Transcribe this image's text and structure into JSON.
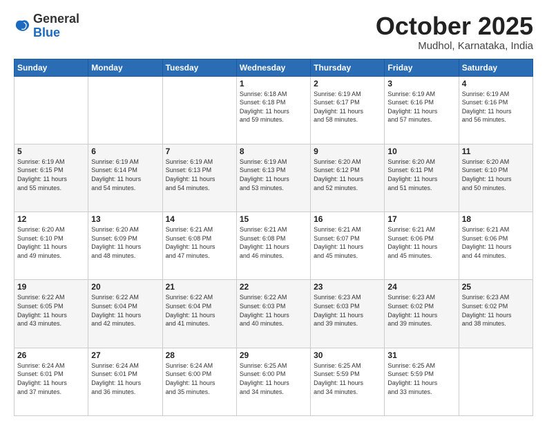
{
  "header": {
    "logo_general": "General",
    "logo_blue": "Blue",
    "month": "October 2025",
    "location": "Mudhol, Karnataka, India"
  },
  "weekdays": [
    "Sunday",
    "Monday",
    "Tuesday",
    "Wednesday",
    "Thursday",
    "Friday",
    "Saturday"
  ],
  "weeks": [
    [
      {
        "day": "",
        "info": ""
      },
      {
        "day": "",
        "info": ""
      },
      {
        "day": "",
        "info": ""
      },
      {
        "day": "1",
        "info": "Sunrise: 6:18 AM\nSunset: 6:18 PM\nDaylight: 11 hours\nand 59 minutes."
      },
      {
        "day": "2",
        "info": "Sunrise: 6:19 AM\nSunset: 6:17 PM\nDaylight: 11 hours\nand 58 minutes."
      },
      {
        "day": "3",
        "info": "Sunrise: 6:19 AM\nSunset: 6:16 PM\nDaylight: 11 hours\nand 57 minutes."
      },
      {
        "day": "4",
        "info": "Sunrise: 6:19 AM\nSunset: 6:16 PM\nDaylight: 11 hours\nand 56 minutes."
      }
    ],
    [
      {
        "day": "5",
        "info": "Sunrise: 6:19 AM\nSunset: 6:15 PM\nDaylight: 11 hours\nand 55 minutes."
      },
      {
        "day": "6",
        "info": "Sunrise: 6:19 AM\nSunset: 6:14 PM\nDaylight: 11 hours\nand 54 minutes."
      },
      {
        "day": "7",
        "info": "Sunrise: 6:19 AM\nSunset: 6:13 PM\nDaylight: 11 hours\nand 54 minutes."
      },
      {
        "day": "8",
        "info": "Sunrise: 6:19 AM\nSunset: 6:13 PM\nDaylight: 11 hours\nand 53 minutes."
      },
      {
        "day": "9",
        "info": "Sunrise: 6:20 AM\nSunset: 6:12 PM\nDaylight: 11 hours\nand 52 minutes."
      },
      {
        "day": "10",
        "info": "Sunrise: 6:20 AM\nSunset: 6:11 PM\nDaylight: 11 hours\nand 51 minutes."
      },
      {
        "day": "11",
        "info": "Sunrise: 6:20 AM\nSunset: 6:10 PM\nDaylight: 11 hours\nand 50 minutes."
      }
    ],
    [
      {
        "day": "12",
        "info": "Sunrise: 6:20 AM\nSunset: 6:10 PM\nDaylight: 11 hours\nand 49 minutes."
      },
      {
        "day": "13",
        "info": "Sunrise: 6:20 AM\nSunset: 6:09 PM\nDaylight: 11 hours\nand 48 minutes."
      },
      {
        "day": "14",
        "info": "Sunrise: 6:21 AM\nSunset: 6:08 PM\nDaylight: 11 hours\nand 47 minutes."
      },
      {
        "day": "15",
        "info": "Sunrise: 6:21 AM\nSunset: 6:08 PM\nDaylight: 11 hours\nand 46 minutes."
      },
      {
        "day": "16",
        "info": "Sunrise: 6:21 AM\nSunset: 6:07 PM\nDaylight: 11 hours\nand 45 minutes."
      },
      {
        "day": "17",
        "info": "Sunrise: 6:21 AM\nSunset: 6:06 PM\nDaylight: 11 hours\nand 45 minutes."
      },
      {
        "day": "18",
        "info": "Sunrise: 6:21 AM\nSunset: 6:06 PM\nDaylight: 11 hours\nand 44 minutes."
      }
    ],
    [
      {
        "day": "19",
        "info": "Sunrise: 6:22 AM\nSunset: 6:05 PM\nDaylight: 11 hours\nand 43 minutes."
      },
      {
        "day": "20",
        "info": "Sunrise: 6:22 AM\nSunset: 6:04 PM\nDaylight: 11 hours\nand 42 minutes."
      },
      {
        "day": "21",
        "info": "Sunrise: 6:22 AM\nSunset: 6:04 PM\nDaylight: 11 hours\nand 41 minutes."
      },
      {
        "day": "22",
        "info": "Sunrise: 6:22 AM\nSunset: 6:03 PM\nDaylight: 11 hours\nand 40 minutes."
      },
      {
        "day": "23",
        "info": "Sunrise: 6:23 AM\nSunset: 6:03 PM\nDaylight: 11 hours\nand 39 minutes."
      },
      {
        "day": "24",
        "info": "Sunrise: 6:23 AM\nSunset: 6:02 PM\nDaylight: 11 hours\nand 39 minutes."
      },
      {
        "day": "25",
        "info": "Sunrise: 6:23 AM\nSunset: 6:02 PM\nDaylight: 11 hours\nand 38 minutes."
      }
    ],
    [
      {
        "day": "26",
        "info": "Sunrise: 6:24 AM\nSunset: 6:01 PM\nDaylight: 11 hours\nand 37 minutes."
      },
      {
        "day": "27",
        "info": "Sunrise: 6:24 AM\nSunset: 6:01 PM\nDaylight: 11 hours\nand 36 minutes."
      },
      {
        "day": "28",
        "info": "Sunrise: 6:24 AM\nSunset: 6:00 PM\nDaylight: 11 hours\nand 35 minutes."
      },
      {
        "day": "29",
        "info": "Sunrise: 6:25 AM\nSunset: 6:00 PM\nDaylight: 11 hours\nand 34 minutes."
      },
      {
        "day": "30",
        "info": "Sunrise: 6:25 AM\nSunset: 5:59 PM\nDaylight: 11 hours\nand 34 minutes."
      },
      {
        "day": "31",
        "info": "Sunrise: 6:25 AM\nSunset: 5:59 PM\nDaylight: 11 hours\nand 33 minutes."
      },
      {
        "day": "",
        "info": ""
      }
    ]
  ]
}
